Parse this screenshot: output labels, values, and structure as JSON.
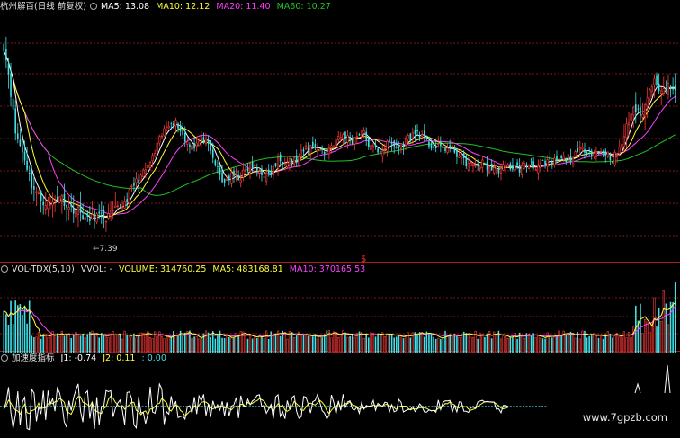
{
  "price_panel": {
    "title": "杭州解百(日线 前复权)",
    "ma5_label": "MA5: 13.08",
    "ma10_label": "MA10: 12.12",
    "ma20_label": "MA20: 11.40",
    "ma60_label": "MA60: 10.27",
    "low_marker": "7.39",
    "dividend_marker": "$"
  },
  "volume_panel": {
    "title": "VOL-TDX(5,10)",
    "vvol_label": "VVOL: -",
    "volume_label": "VOLUME: 314760.25",
    "ma5_label": "MA5: 483168.81",
    "ma10_label": "MA10: 370165.53"
  },
  "indicator_panel": {
    "title": "加速度指标",
    "j1_label": "J1: -0.74",
    "j2_label": "J2: 0.11",
    "extra_label": ": 0.00"
  },
  "watermark": "www.7gpzb.com",
  "colors": {
    "up": "#ff3b3b",
    "down": "#40e0e6",
    "ma5": "#ffffff",
    "ma10": "#ffff3c",
    "ma20": "#ff40ff",
    "ma60": "#22c022",
    "grid": "#7a1a1a",
    "j1": "#ffffff",
    "j2": "#ffff3c",
    "zero": "#40e0e6"
  },
  "chart_data": {
    "type": "candlestick",
    "price_axis": {
      "low": 7.39,
      "high": 15.6
    },
    "close_anchors": [
      [
        0,
        14.9
      ],
      [
        2,
        13.9
      ],
      [
        5,
        11.6
      ],
      [
        9,
        10.6
      ],
      [
        12,
        9.6
      ],
      [
        16,
        9.0
      ],
      [
        20,
        8.8
      ],
      [
        24,
        9.2
      ],
      [
        28,
        8.7
      ],
      [
        32,
        8.6
      ],
      [
        36,
        8.2
      ],
      [
        40,
        8.4
      ],
      [
        44,
        8.3
      ],
      [
        48,
        8.6
      ],
      [
        52,
        8.9
      ],
      [
        56,
        9.6
      ],
      [
        60,
        10.0
      ],
      [
        64,
        10.6
      ],
      [
        68,
        11.5
      ],
      [
        72,
        12.1
      ],
      [
        75,
        11.9
      ],
      [
        78,
        11.3
      ],
      [
        82,
        11.1
      ],
      [
        86,
        11.4
      ],
      [
        90,
        10.6
      ],
      [
        94,
        9.7
      ],
      [
        98,
        9.9
      ],
      [
        102,
        9.9
      ],
      [
        106,
        10.3
      ],
      [
        110,
        10.1
      ],
      [
        114,
        9.9
      ],
      [
        118,
        10.5
      ],
      [
        122,
        10.6
      ],
      [
        126,
        10.5
      ],
      [
        130,
        11.0
      ],
      [
        134,
        11.1
      ],
      [
        138,
        10.8
      ],
      [
        142,
        11.2
      ],
      [
        146,
        11.5
      ],
      [
        150,
        11.3
      ],
      [
        154,
        11.7
      ],
      [
        158,
        11.0
      ],
      [
        162,
        10.9
      ],
      [
        166,
        11.2
      ],
      [
        170,
        11.0
      ],
      [
        174,
        11.4
      ],
      [
        178,
        11.6
      ],
      [
        182,
        11.2
      ],
      [
        186,
        11.0
      ],
      [
        190,
        11.0
      ],
      [
        194,
        10.9
      ],
      [
        198,
        10.5
      ],
      [
        202,
        10.3
      ],
      [
        206,
        10.4
      ],
      [
        210,
        10.2
      ],
      [
        214,
        10.2
      ],
      [
        218,
        10.3
      ],
      [
        222,
        10.2
      ],
      [
        226,
        10.4
      ],
      [
        230,
        10.3
      ],
      [
        234,
        10.4
      ],
      [
        238,
        10.5
      ],
      [
        242,
        10.6
      ],
      [
        246,
        10.7
      ],
      [
        250,
        11.0
      ],
      [
        254,
        10.8
      ],
      [
        258,
        10.9
      ],
      [
        262,
        10.6
      ],
      [
        265,
        10.9
      ],
      [
        268,
        11.8
      ],
      [
        271,
        12.6
      ],
      [
        274,
        12.2
      ],
      [
        277,
        12.9
      ],
      [
        280,
        13.8
      ],
      [
        283,
        13.1
      ],
      [
        286,
        13.5
      ],
      [
        289,
        13.08
      ]
    ]
  }
}
